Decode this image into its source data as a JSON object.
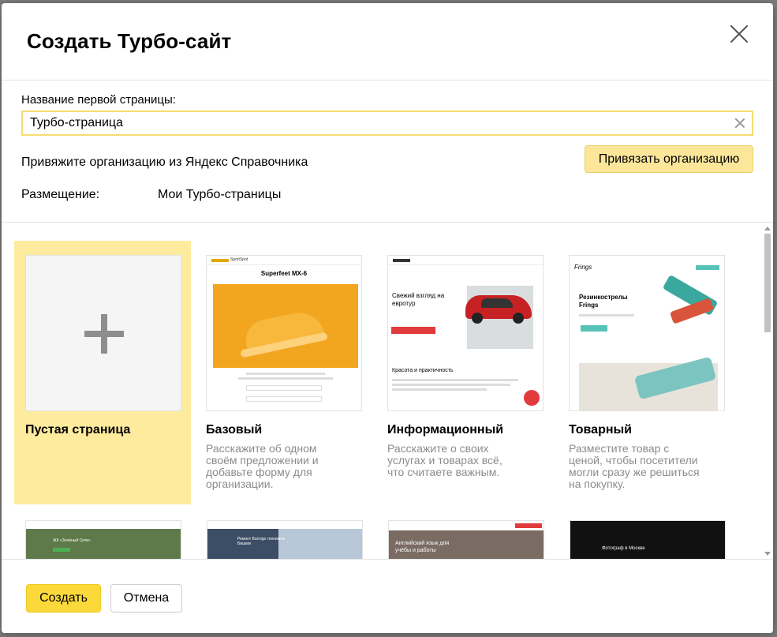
{
  "dialog": {
    "title": "Создать Турбо-сайт"
  },
  "form": {
    "name_label": "Название первой страницы:",
    "name_value": "Турбо-страница",
    "org_text": "Привяжите организацию из Яндекс Справочника",
    "org_button": "Привязать организацию",
    "placement_label": "Размещение:",
    "placement_value": "Мои Турбо-страницы"
  },
  "templates": [
    {
      "title": "Пустая страница",
      "description": "",
      "selected": true
    },
    {
      "title": "Базовый",
      "description": "Расскажите об одном своём предложении и добавьте форму для организации.",
      "selected": false
    },
    {
      "title": "Информационный",
      "description": "Расскажите о своих услугах и товарах всё, что считаете важным.",
      "selected": false
    },
    {
      "title": "Товарный",
      "description": "Разместите товар с ценой, чтобы посетители могли сразу же решиться на покупку.",
      "selected": false
    }
  ],
  "previews": {
    "basic_heading": "Superfeet MX-6",
    "basic_brand": "SportSpot",
    "info_heading": "Свежий взгляд на евротур",
    "info_section": "Красота и практичность",
    "goods_heading": "Резинкострелы Frings",
    "goods_brand": "Frings",
    "row2_a": "ЖК «Зелёный Сити»",
    "row2_b": "Ремонт Burrogo техники в Бишкек",
    "row2_c": "Английский язык для учёбы и работы",
    "row2_d": "Фотограф в Москве"
  },
  "footer": {
    "create": "Создать",
    "cancel": "Отмена"
  },
  "colors": {
    "accent": "#fcd93b",
    "selected_card": "#feeb9e",
    "input_border": "#f6dc6f",
    "org_button": "#fbe69a"
  }
}
